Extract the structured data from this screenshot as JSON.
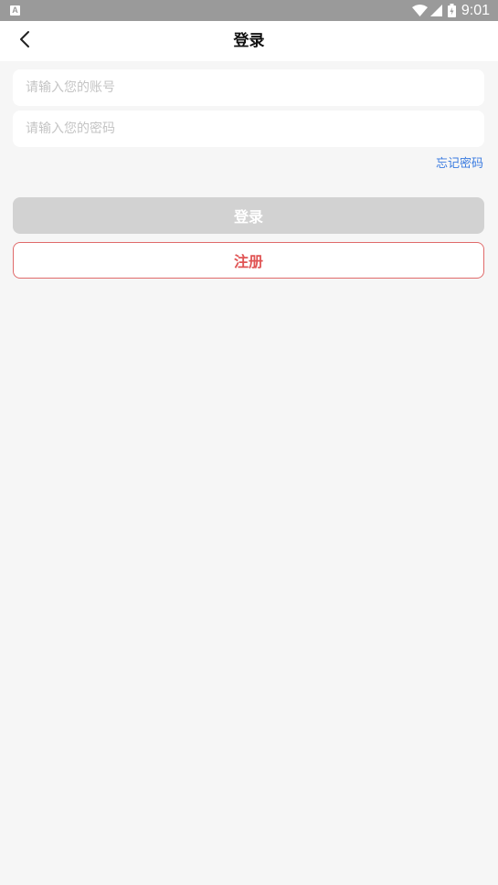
{
  "status_bar": {
    "time": "9:01",
    "app_icon_letter": "A"
  },
  "header": {
    "title": "登录"
  },
  "form": {
    "account_placeholder": "请输入您的账号",
    "password_placeholder": "请输入您的密码",
    "forgot_password": "忘记密码"
  },
  "buttons": {
    "login_label": "登录",
    "register_label": "注册"
  },
  "colors": {
    "status_bar": "#9a9a9a",
    "background": "#f6f6f6",
    "link": "#3a7be0",
    "login_disabled": "#d2d2d2",
    "register_border": "#e06a6a",
    "register_text": "#e05555"
  },
  "icons": {
    "back": "chevron-left-icon",
    "wifi": "wifi-icon",
    "signal": "signal-icon",
    "battery": "battery-icon"
  }
}
